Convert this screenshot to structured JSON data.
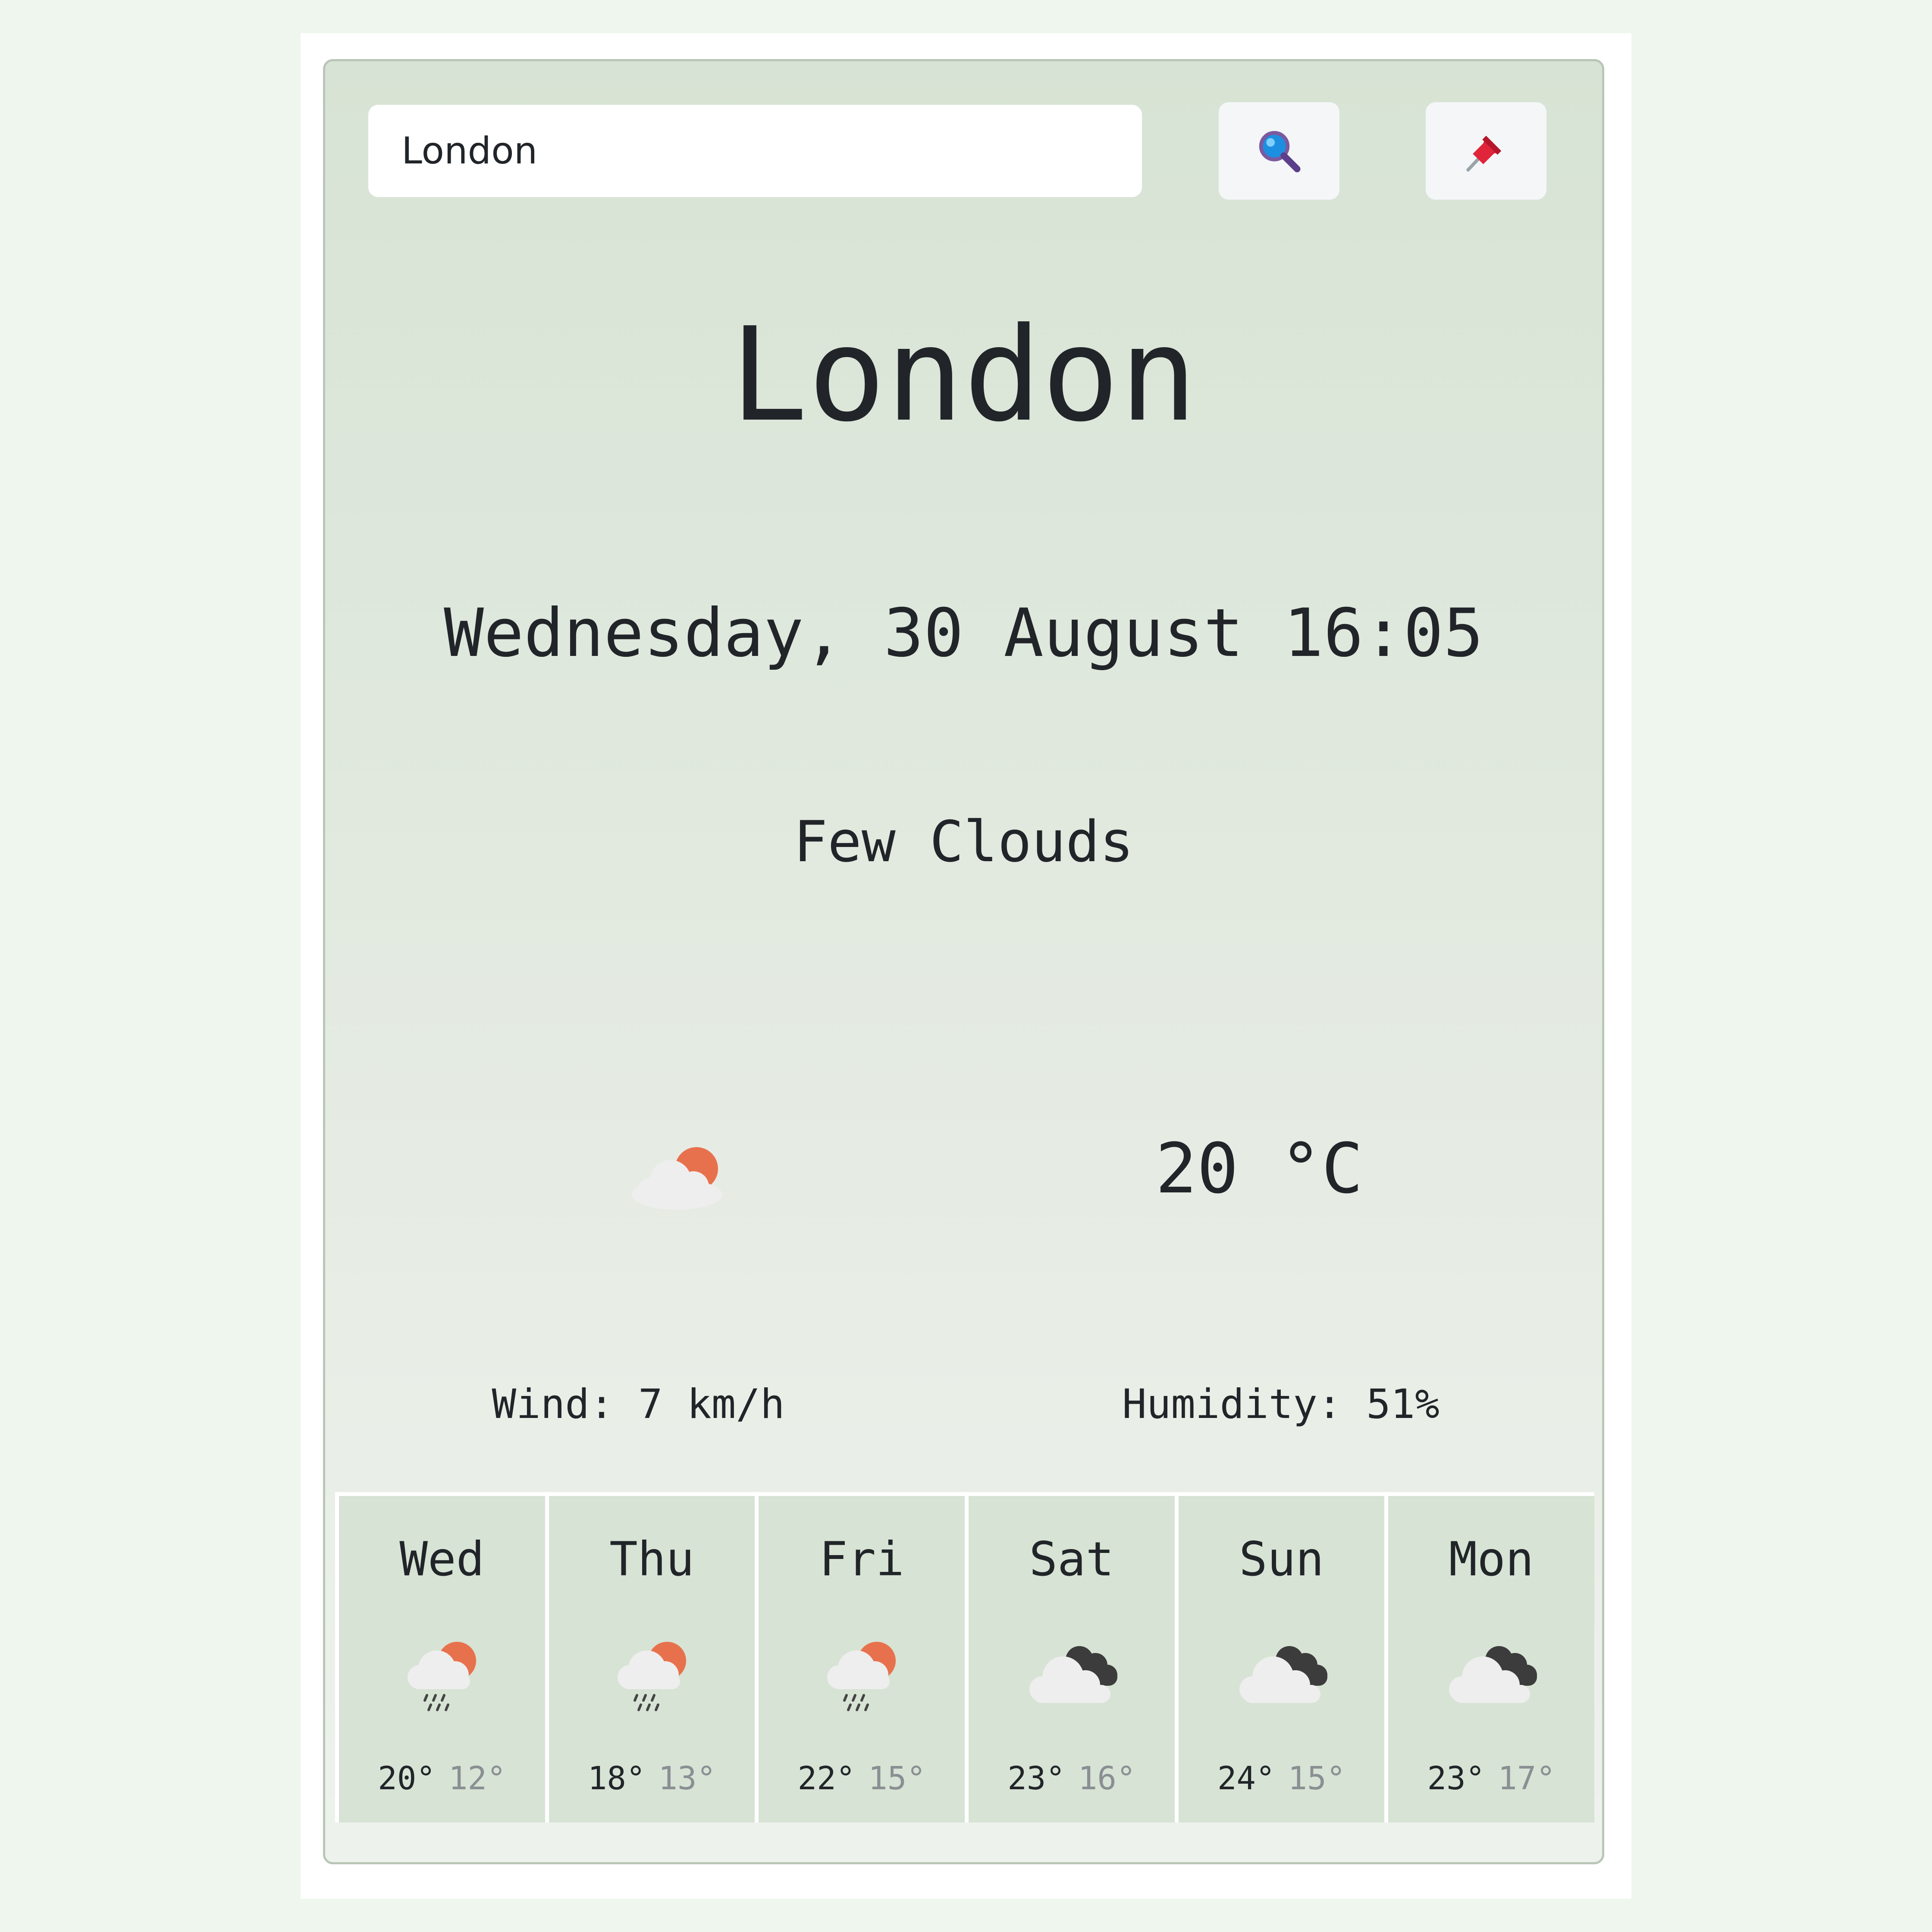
{
  "search": {
    "value": "London",
    "search_icon": "magnifier-icon",
    "pin_icon": "pushpin-icon"
  },
  "current": {
    "city": "London",
    "datetime": "Wednesday, 30 August 16:05",
    "description": "Few Clouds",
    "icon": "partly-cloudy-icon",
    "temperature": "20 °C",
    "wind": "Wind: 7 km/h",
    "humidity": "Humidity: 51%"
  },
  "forecast": [
    {
      "day": "Wed",
      "icon": "rain-sun-icon",
      "high": "20°",
      "low": "12°"
    },
    {
      "day": "Thu",
      "icon": "rain-sun-icon",
      "high": "18°",
      "low": "13°"
    },
    {
      "day": "Fri",
      "icon": "rain-sun-icon",
      "high": "22°",
      "low": "15°"
    },
    {
      "day": "Sat",
      "icon": "cloudy-icon",
      "high": "23°",
      "low": "16°"
    },
    {
      "day": "Sun",
      "icon": "cloudy-icon",
      "high": "24°",
      "low": "15°"
    },
    {
      "day": "Mon",
      "icon": "cloudy-icon",
      "high": "23°",
      "low": "17°"
    }
  ],
  "colors": {
    "page_background": "#eef6ee",
    "card_background": "#d7e3d4",
    "sun": "#e8714d",
    "dark_cloud": "#3c3c3c",
    "light_cloud": "#eeeeee",
    "low_temp": "#8a8f94"
  }
}
